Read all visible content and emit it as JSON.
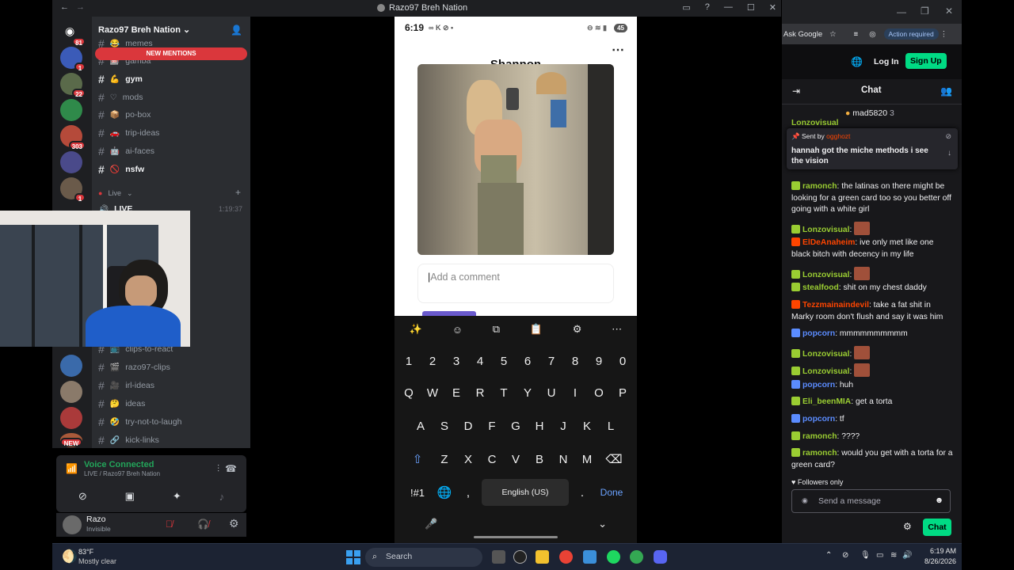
{
  "discord": {
    "window_title": "Razo97 Breh Nation",
    "server_name": "Razo97 Breh Nation",
    "new_mentions": "NEW MENTIONS",
    "server_badges": [
      "81",
      "1",
      "22",
      "303",
      "1",
      "NEW"
    ],
    "channels_top": [
      {
        "name": "memes",
        "emoji": "😂"
      },
      {
        "name": "gamba",
        "emoji": "🎰"
      },
      {
        "name": "gym",
        "emoji": "💪"
      },
      {
        "name": "mods",
        "emoji": "♡"
      },
      {
        "name": "po-box",
        "emoji": "📦"
      },
      {
        "name": "trip-ideas",
        "emoji": "🚗"
      },
      {
        "name": "ai-faces",
        "emoji": "🤖"
      },
      {
        "name": "nsfw",
        "emoji": "🚫"
      }
    ],
    "live_category": "Live",
    "live_channel": "LIVE",
    "live_time": "1:19:37",
    "channels_bottom": [
      {
        "name": "clips-to-react",
        "emoji": "📺"
      },
      {
        "name": "razo97-clips",
        "emoji": "🎬"
      },
      {
        "name": "irl-ideas",
        "emoji": "🎥"
      },
      {
        "name": "ideas",
        "emoji": "🤔"
      },
      {
        "name": "try-not-to-laugh",
        "emoji": "🤣"
      },
      {
        "name": "kick-links",
        "emoji": "🔗"
      }
    ],
    "voice_status": "Voice Connected",
    "voice_channel": "LIVE / Razo97 Breh Nation",
    "username": "Razo",
    "user_status": "Invisible"
  },
  "phone": {
    "time": "6:19",
    "battery": "45",
    "title": "Shannon",
    "comment_placeholder": "Add a comment",
    "keyboard": {
      "numbers": [
        "1",
        "2",
        "3",
        "4",
        "5",
        "6",
        "7",
        "8",
        "9",
        "0"
      ],
      "row1": [
        "Q",
        "W",
        "E",
        "R",
        "T",
        "Y",
        "U",
        "I",
        "O",
        "P"
      ],
      "row2": [
        "A",
        "S",
        "D",
        "F",
        "G",
        "H",
        "J",
        "K",
        "L"
      ],
      "row3": [
        "Z",
        "X",
        "C",
        "V",
        "B",
        "N",
        "M"
      ],
      "symbols": "!#1",
      "comma": ",",
      "space": "English (US)",
      "period": ".",
      "done": "Done"
    }
  },
  "browser": {
    "ask_google": "Ask Google",
    "action_required": "Action required",
    "login": "Log In",
    "signup": "Sign Up",
    "chat_title": "Chat",
    "top_gifter": "mad5820",
    "top_gifter_count": "3",
    "pinned_by_label": "Sent by",
    "pinned_by_user": "ogghozt",
    "pinned_text": "hannah got the miche methods i see the vision",
    "messages": [
      {
        "user": "ramonch",
        "color": "#9acd32",
        "text": "the latinas on there might be looking for a green card too so you better off going with a white girl"
      },
      {
        "user": "Lonzovisual",
        "color": "#9acd32",
        "text": ""
      },
      {
        "user": "ElDeAnaheim",
        "color": "#ff4500",
        "text": "ive only met like one black bitch with decency in my life"
      },
      {
        "user": "Lonzovisual",
        "color": "#9acd32",
        "text": ""
      },
      {
        "user": "stealfood",
        "color": "#9acd32",
        "text": "shit on my chest daddy"
      },
      {
        "user": "Tezzmainaindevil",
        "color": "#ff4500",
        "text": "take a fat shit in Marky room don't flush and say it was him"
      },
      {
        "user": "popcorn",
        "color": "#5b8cff",
        "text": "mmmmmmmmmm"
      },
      {
        "user": "Lonzovisual",
        "color": "#9acd32",
        "text": ""
      },
      {
        "user": "Lonzovisual",
        "color": "#9acd32",
        "text": ""
      },
      {
        "user": "popcorn",
        "color": "#5b8cff",
        "text": "huh"
      },
      {
        "user": "Eli_beenMIA",
        "color": "#9acd32",
        "text": "get a torta"
      },
      {
        "user": "popcorn",
        "color": "#5b8cff",
        "text": "tf"
      },
      {
        "user": "ramonch",
        "color": "#9acd32",
        "text": "????"
      },
      {
        "user": "ramonch",
        "color": "#9acd32",
        "text": "would you get with a torta for a green card?"
      }
    ],
    "followers_only": "Followers only",
    "send_placeholder": "Send a message",
    "chat_button": "Chat"
  },
  "taskbar": {
    "temp": "83°F",
    "weather": "Mostly clear",
    "search": "Search",
    "time": "6:19 AM",
    "date": "8/26/2026"
  }
}
